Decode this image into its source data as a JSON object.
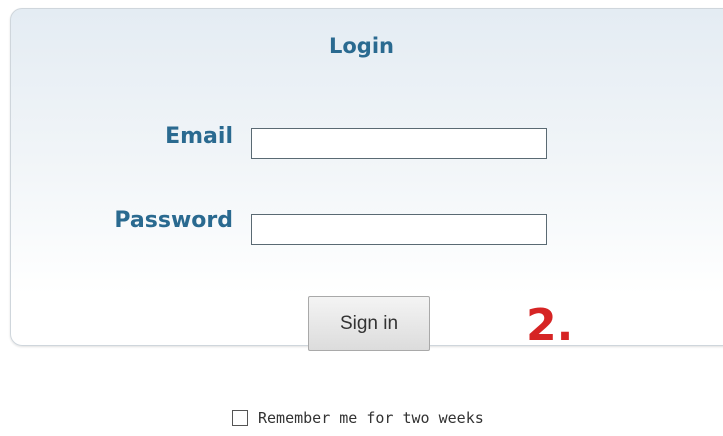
{
  "login": {
    "title": "Login",
    "email_label": "Email",
    "email_value": "",
    "password_label": "Password",
    "password_value": "",
    "sign_in_label": "Sign in",
    "remember_label": "Remember me for two weeks",
    "remember_checked": false
  },
  "annotation": {
    "step_number": "2."
  },
  "colors": {
    "label_blue": "#2a6a90",
    "annotation_red": "#d62424"
  }
}
